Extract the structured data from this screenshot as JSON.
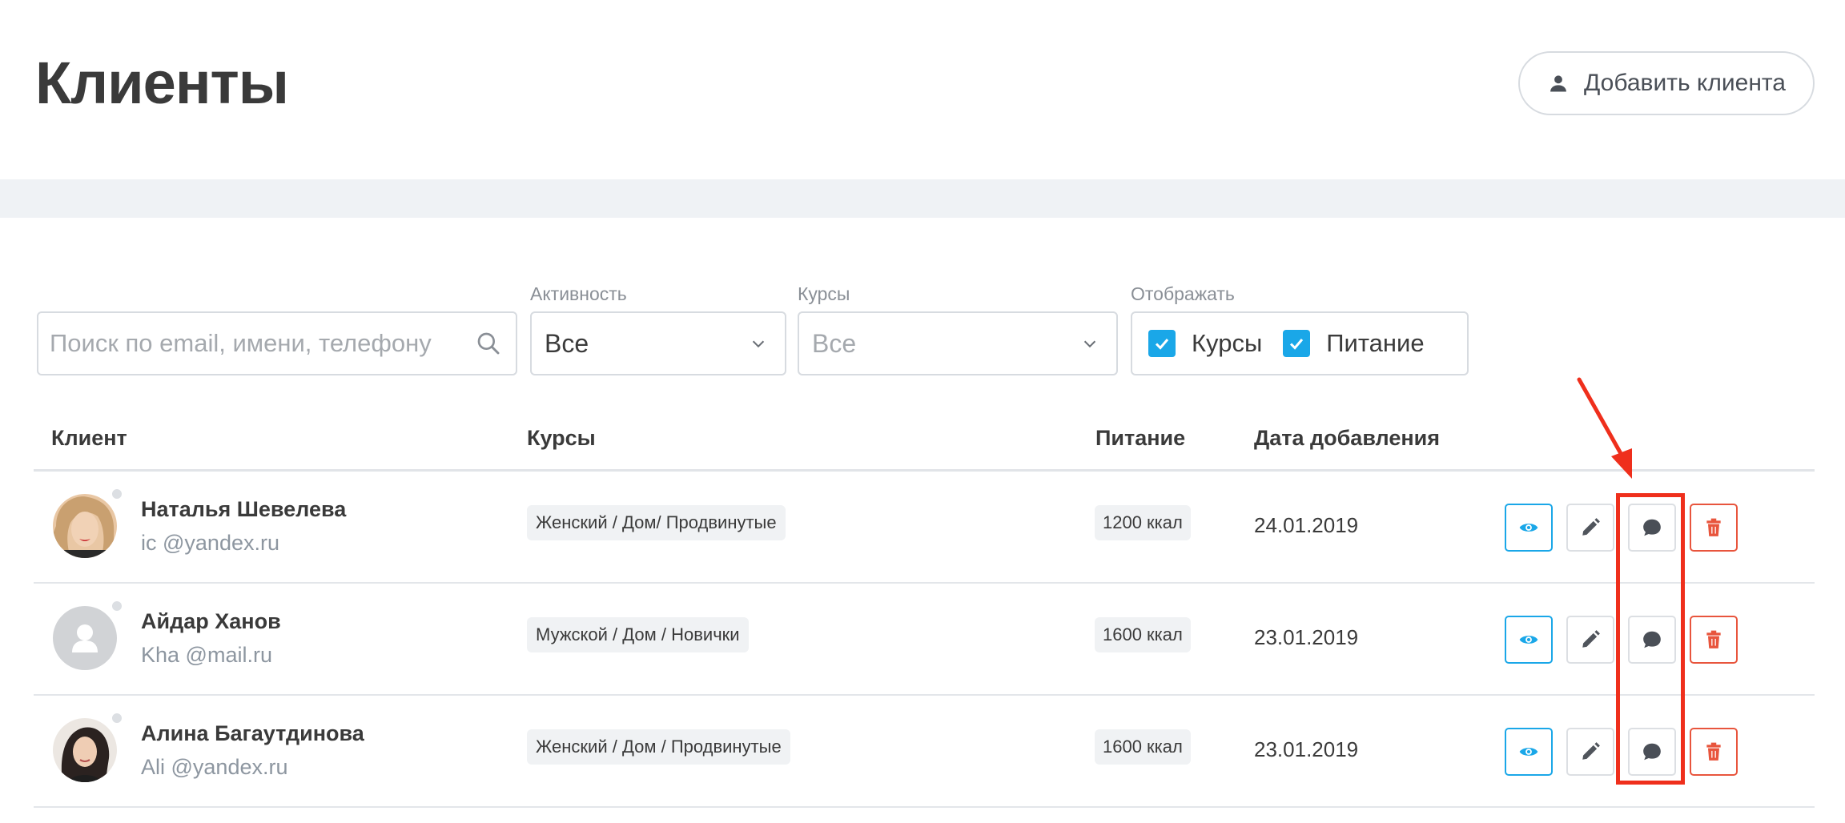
{
  "header": {
    "title": "Клиенты",
    "add_button_label": "Добавить клиента"
  },
  "filters": {
    "search_placeholder": "Поиск по email, имени, телефону",
    "activity": {
      "label": "Активность",
      "value": "Все"
    },
    "courses": {
      "label": "Курсы",
      "value": "Все"
    },
    "display": {
      "label": "Отображать",
      "options": [
        {
          "label": "Курсы",
          "checked": true
        },
        {
          "label": "Питание",
          "checked": true
        }
      ]
    }
  },
  "table": {
    "columns": [
      "Клиент",
      "Курсы",
      "Питание",
      "Дата добавления"
    ],
    "rows": [
      {
        "name": "Наталья Шевелева",
        "email": "ic            @yandex.ru",
        "course": "Женский / Дом/ Продвинутые",
        "nutrition": "1200 ккал",
        "date": "24.01.2019",
        "avatar": "photo-woman-blonde"
      },
      {
        "name": "Айдар Ханов",
        "email": "Kha                  @mail.ru",
        "course": "Мужской / Дом / Новички",
        "nutrition": "1600 ккал",
        "date": "23.01.2019",
        "avatar": "placeholder-user"
      },
      {
        "name": "Алина Багаутдинова",
        "email": "Ali            @yandex.ru",
        "course": "Женский / Дом / Продвинутые",
        "nutrition": "1600 ккал",
        "date": "23.01.2019",
        "avatar": "photo-woman-dark-hair"
      }
    ]
  },
  "icons": {
    "view": "eye-icon",
    "edit": "pencil-icon",
    "chat": "chat-bubble-icon",
    "delete": "trash-icon"
  },
  "colors": {
    "accent": "#1aa7e8",
    "danger": "#e8553d",
    "annotation": "#ef2f1c"
  }
}
